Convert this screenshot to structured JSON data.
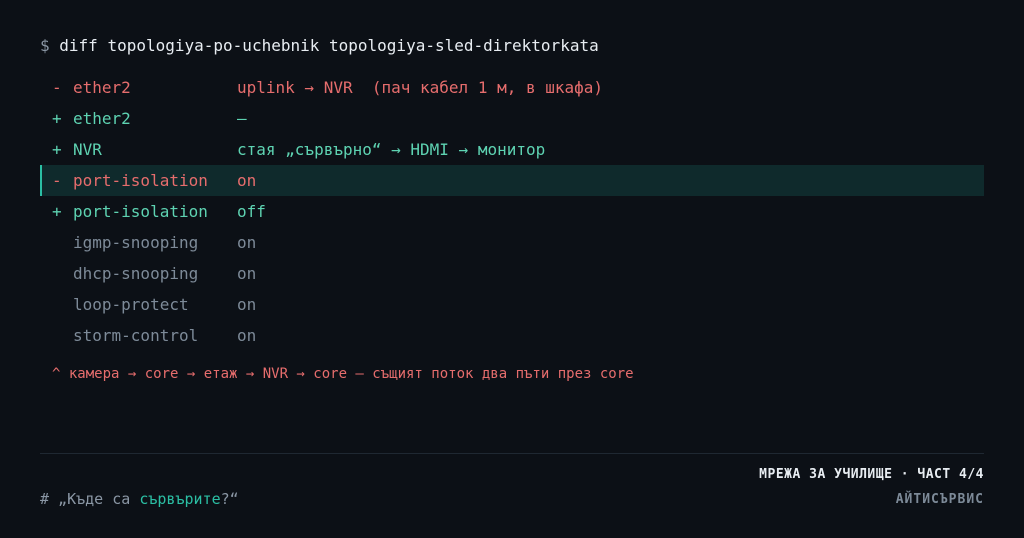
{
  "command": {
    "prompt": "$",
    "text": "diff topologiya-po-uchebnik topologiya-sled-direktorkata"
  },
  "diff": [
    {
      "sign": "-",
      "key": "ether2",
      "value": "uplink → NVR  (пач кабел 1 м, в шкафа)",
      "kind": "removed",
      "highlight": false
    },
    {
      "sign": "+",
      "key": "ether2",
      "value": "—",
      "kind": "added",
      "highlight": false
    },
    {
      "sign": "+",
      "key": "NVR",
      "value": "стая „сървърно“ → HDMI → монитор",
      "kind": "added",
      "highlight": false
    },
    {
      "sign": "-",
      "key": "port-isolation",
      "value": "on",
      "kind": "removed",
      "highlight": true
    },
    {
      "sign": "+",
      "key": "port-isolation",
      "value": "off",
      "kind": "added",
      "highlight": false
    },
    {
      "sign": "",
      "key": "igmp-snooping",
      "value": "on",
      "kind": "context",
      "highlight": false
    },
    {
      "sign": "",
      "key": "dhcp-snooping",
      "value": "on",
      "kind": "context",
      "highlight": false
    },
    {
      "sign": "",
      "key": "loop-protect",
      "value": "on",
      "kind": "context",
      "highlight": false
    },
    {
      "sign": "",
      "key": "storm-control",
      "value": "on",
      "kind": "context",
      "highlight": false
    }
  ],
  "annotation": "^ камера → core → етаж → NVR → core — същият поток два пъти през core",
  "footer": {
    "comment_prefix": "# „Къде са ",
    "comment_highlight": "сървърите",
    "comment_suffix": "?“",
    "series": "МРЕЖА ЗА УЧИЛИЩЕ · ЧАСТ 4/4",
    "brand": "АЙТИСЪРВИС"
  },
  "colors": {
    "background": "#0c1016",
    "removed": "#e66d6d",
    "added": "#5ed3b2",
    "context": "#7d8a98",
    "accent": "#2bbfa4",
    "highlight_bg": "#0f2a2c"
  }
}
